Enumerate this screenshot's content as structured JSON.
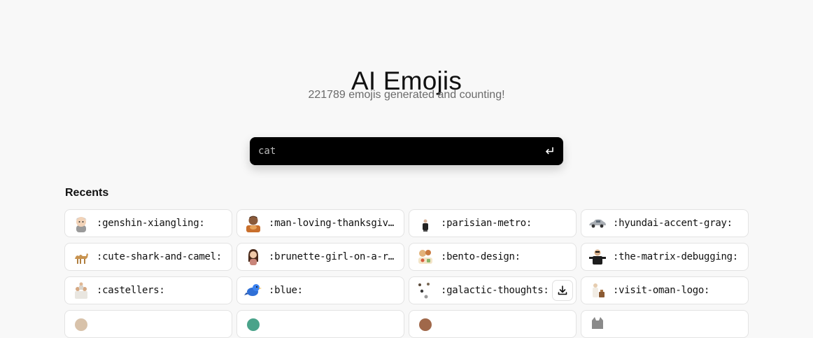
{
  "header": {
    "title": "AI Emojis",
    "subtitle": "221789 emojis generated and counting!"
  },
  "search": {
    "placeholder": "cat",
    "value": "",
    "submit_icon": "enter-return-icon"
  },
  "recents": {
    "label": "Recents",
    "items": [
      {
        "name": ":genshin-xiangling:",
        "icon": "genshin-xiangling-emoji"
      },
      {
        "name": ":man-loving-thanksgiving:",
        "icon": "man-thanksgiving-emoji"
      },
      {
        "name": ":parisian-metro:",
        "icon": "parisian-metro-emoji"
      },
      {
        "name": ":hyundai-accent-gray:",
        "icon": "gray-car-emoji"
      },
      {
        "name": ":cute-shark-and-camel:",
        "icon": "shark-camel-emoji"
      },
      {
        "name": ":brunette-girl-on-a-road:",
        "icon": "brunette-girl-emoji"
      },
      {
        "name": ":bento-design:",
        "icon": "bento-emoji"
      },
      {
        "name": ":the-matrix-debugging:",
        "icon": "matrix-debugging-emoji"
      },
      {
        "name": ":castellers:",
        "icon": "castellers-emoji"
      },
      {
        "name": ":blue:",
        "icon": "blue-bird-emoji"
      },
      {
        "name": ":galactic-thoughts:",
        "icon": "galactic-thoughts-emoji",
        "hovered": true
      },
      {
        "name": ":visit-oman-logo:",
        "icon": "visit-oman-emoji"
      }
    ]
  },
  "colors": {
    "background": "#f8f8f8",
    "search_bg": "#000000",
    "card_border": "#e3e3e3",
    "subtitle": "#6b6b6b"
  }
}
